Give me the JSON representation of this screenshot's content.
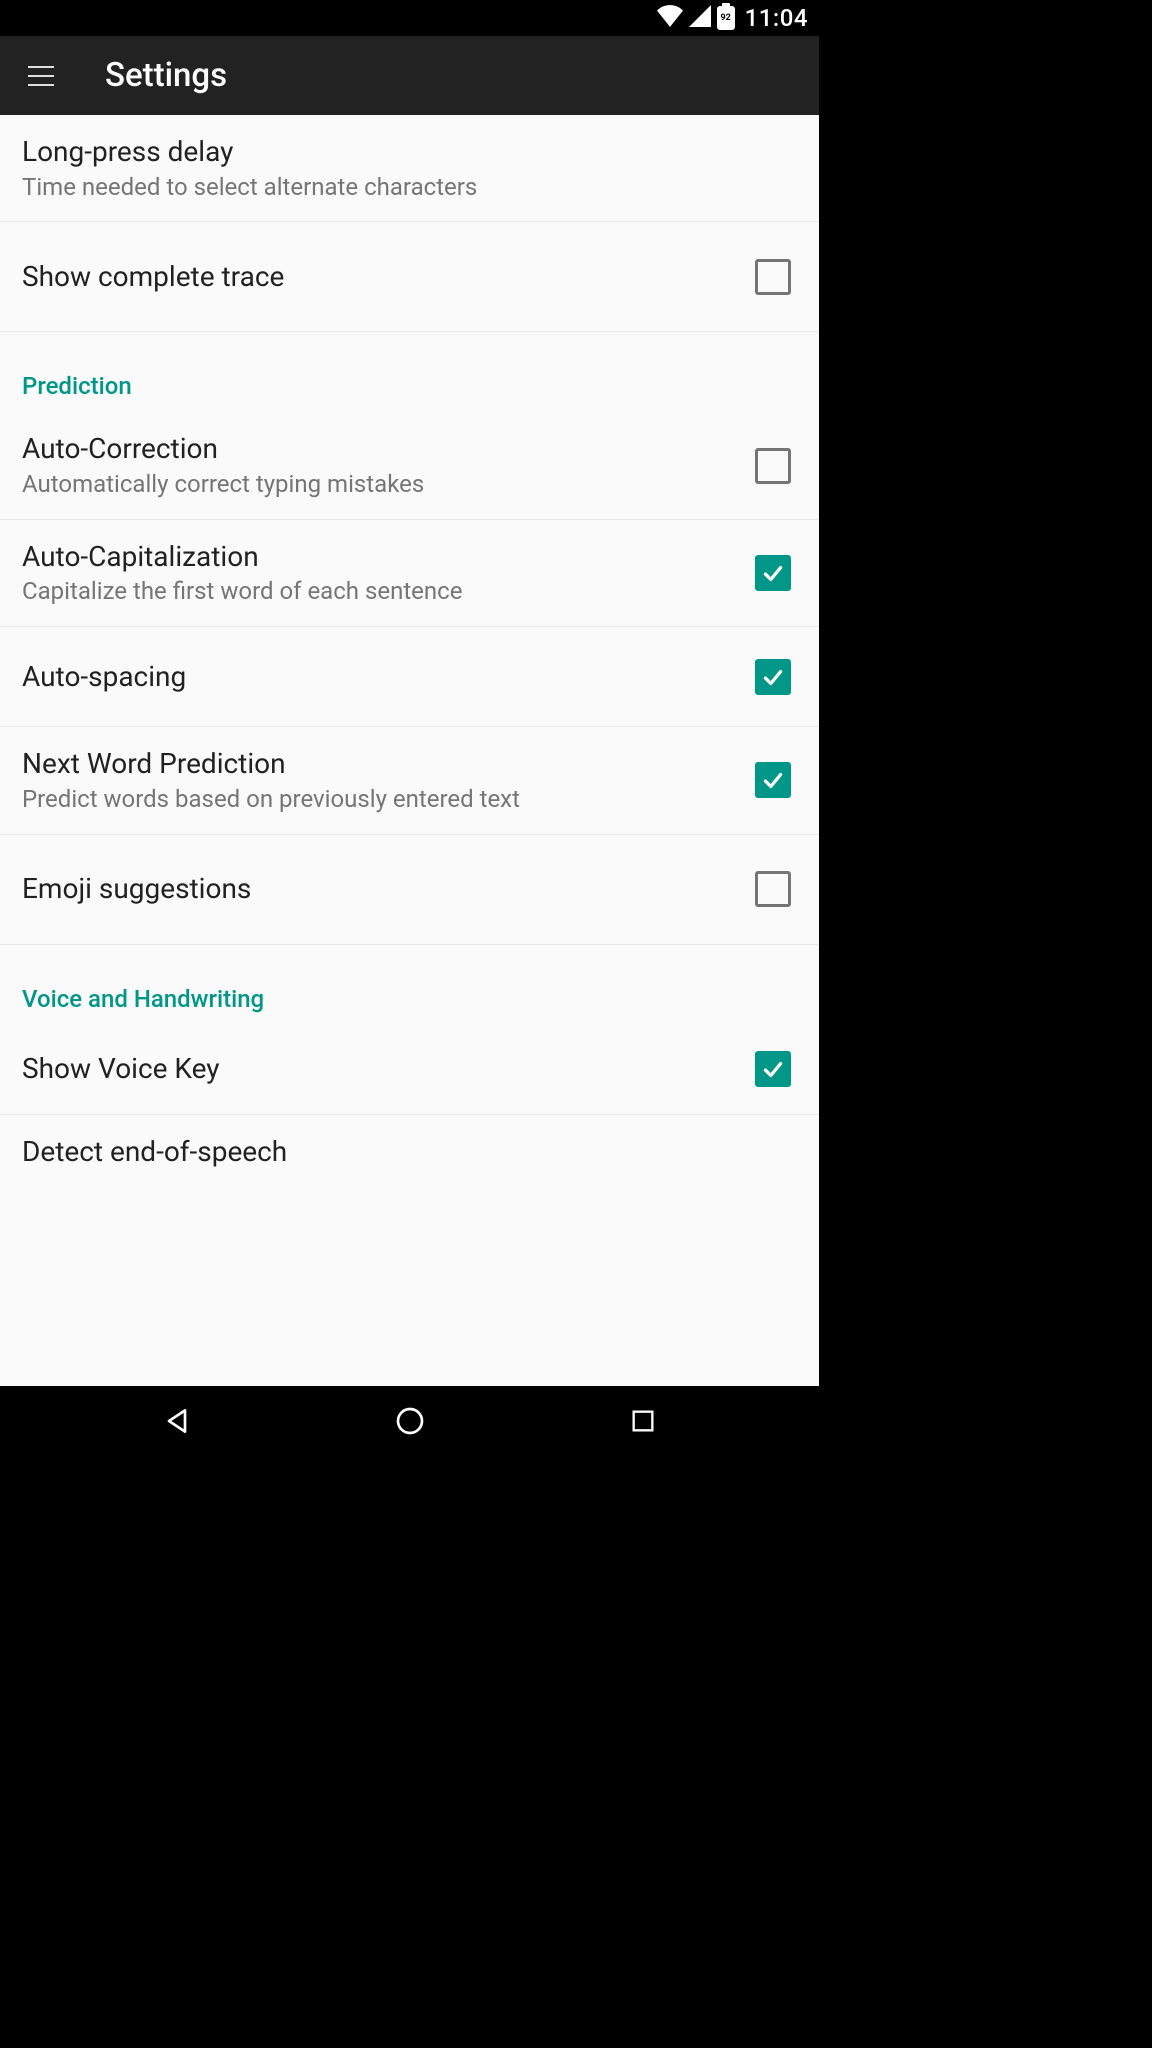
{
  "status_bar": {
    "battery_level": "92",
    "clock": "11:04"
  },
  "app_bar": {
    "title": "Settings"
  },
  "sections": {
    "general": {
      "long_press": {
        "title": "Long-press delay",
        "subtitle": "Time needed to select alternate characters"
      },
      "show_trace": {
        "title": "Show complete trace",
        "checked": false
      }
    },
    "prediction": {
      "header": "Prediction",
      "auto_correction": {
        "title": "Auto-Correction",
        "subtitle": "Automatically correct typing mistakes",
        "checked": false
      },
      "auto_capitalization": {
        "title": "Auto-Capitalization",
        "subtitle": "Capitalize the first word of each sentence",
        "checked": true
      },
      "auto_spacing": {
        "title": "Auto-spacing",
        "checked": true
      },
      "next_word": {
        "title": "Next Word Prediction",
        "subtitle": "Predict words based on previously entered text",
        "checked": true
      },
      "emoji": {
        "title": "Emoji suggestions",
        "checked": false
      }
    },
    "voice": {
      "header": "Voice and Handwriting",
      "show_voice_key": {
        "title": "Show Voice Key",
        "checked": true
      },
      "detect_eos": {
        "title": "Detect end-of-speech"
      }
    }
  }
}
